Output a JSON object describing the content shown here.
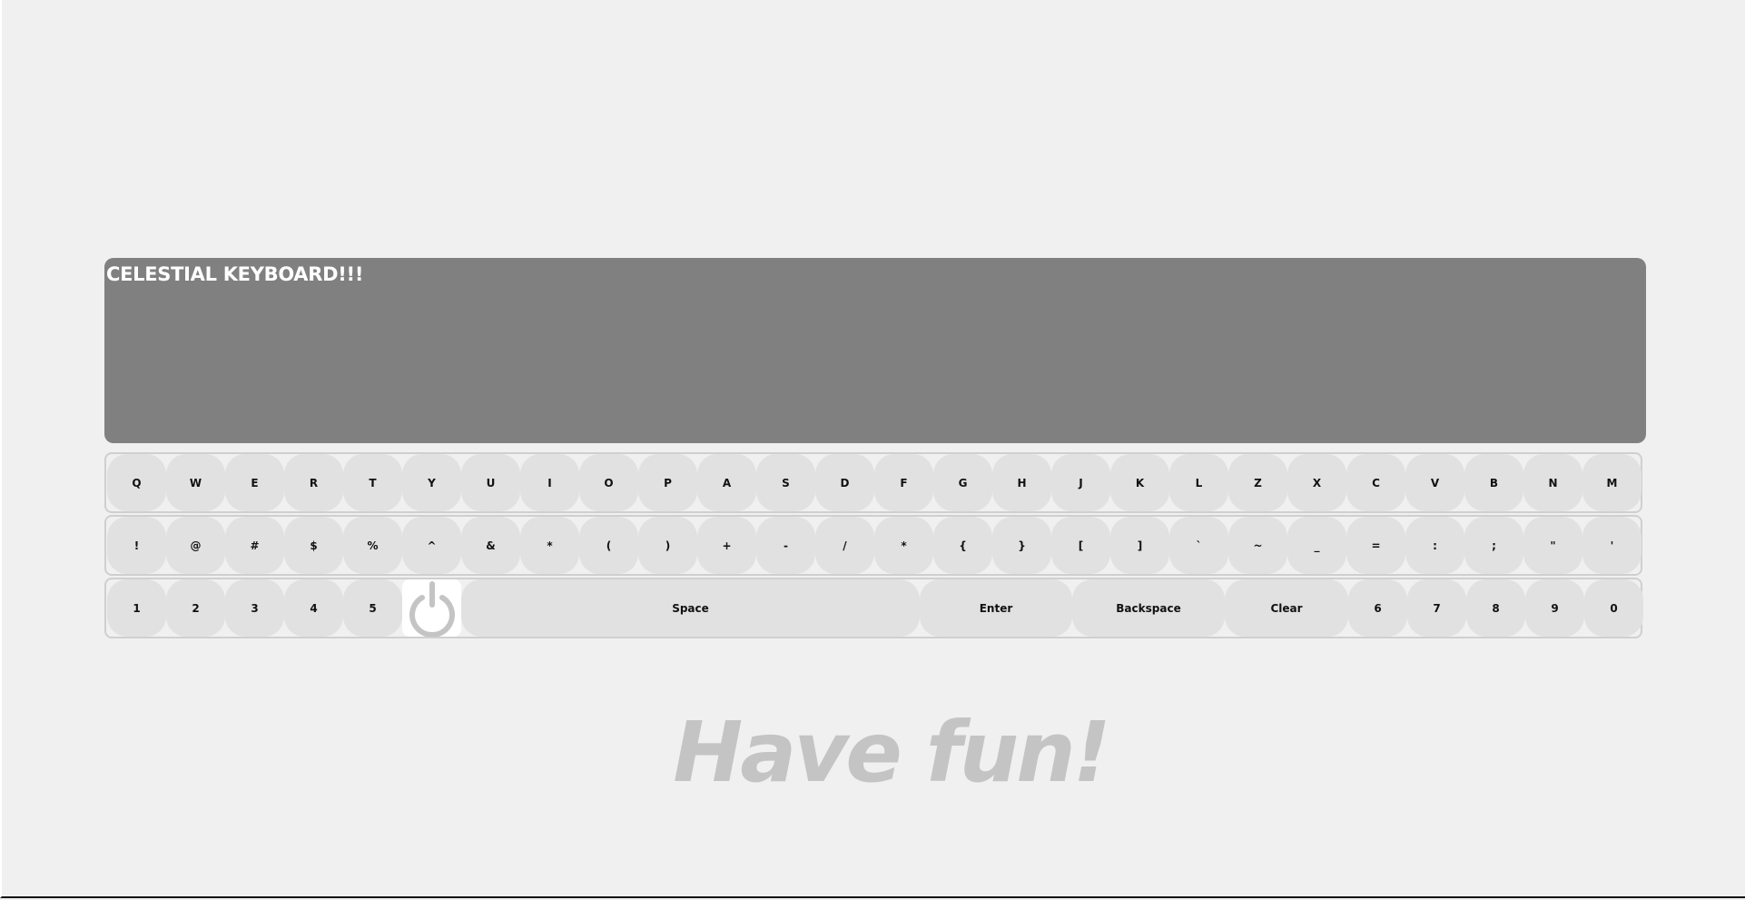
{
  "display": {
    "text": "CELESTIAL KEYBOARD!!!"
  },
  "keyboard": {
    "row1": [
      "Q",
      "W",
      "E",
      "R",
      "T",
      "Y",
      "U",
      "I",
      "O",
      "P",
      "A",
      "S",
      "D",
      "F",
      "G",
      "H",
      "J",
      "K",
      "L",
      "Z",
      "X",
      "C",
      "V",
      "B",
      "N",
      "M"
    ],
    "row2": [
      "!",
      "@",
      "#",
      "$",
      "%",
      "^",
      "&",
      "*",
      "(",
      ")",
      "+",
      "-",
      "/",
      "*",
      "{",
      "}",
      "[",
      "]",
      "`",
      "~",
      "_",
      "=",
      ":",
      ";",
      "\"",
      "'"
    ],
    "row3": {
      "left_digits": [
        "1",
        "2",
        "3",
        "4",
        "5"
      ],
      "power_icon": "power-icon",
      "space_label": "Space",
      "enter_label": "Enter",
      "backspace_label": "Backspace",
      "clear_label": "Clear",
      "right_digits": [
        "6",
        "7",
        "8",
        "9",
        "0"
      ]
    }
  },
  "tagline": "Have fun!",
  "colors": {
    "background": "#f0f0f0",
    "display": "#808080",
    "key": "#e1e1e1",
    "tagline": "#c4c4c4",
    "power_icon": "#c4c4c4"
  }
}
